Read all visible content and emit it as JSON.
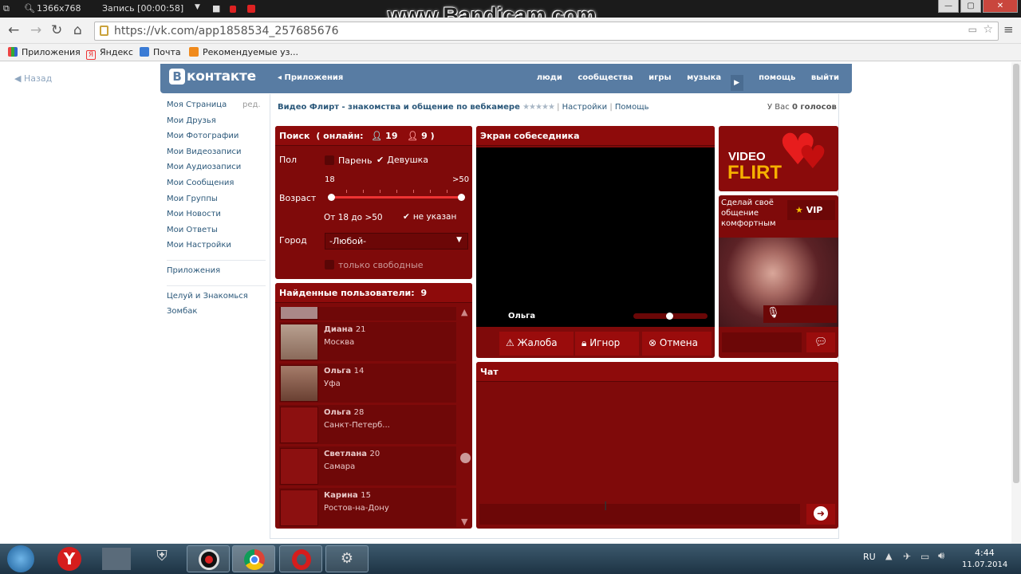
{
  "bandicam": {
    "resolution": "1366x768",
    "recording": "Запись [00:00:58]",
    "watermark": "www.Bandicam.com"
  },
  "browser": {
    "url": "https://vk.com/app1858534_257685676"
  },
  "bookmarks": [
    "Приложения",
    "Яндекс",
    "Почта",
    "Рекомендуемые уз..."
  ],
  "vk": {
    "logo": "контакте",
    "apps_link": "Приложения",
    "nav": [
      "люди",
      "сообщества",
      "игры",
      "музыка",
      "помощь",
      "выйти"
    ],
    "back": "Назад",
    "edit": "ред.",
    "sidebar": [
      "Моя Страница",
      "Мои Друзья",
      "Мои Фотографии",
      "Мои Видеозаписи",
      "Мои Аудиозаписи",
      "Мои Сообщения",
      "Мои Группы",
      "Мои Новости",
      "Мои Ответы",
      "Мои Настройки"
    ],
    "sidebar_apps": "Приложения",
    "sidebar_games": [
      "Целуй и Знакомься",
      "Зомбак"
    ],
    "app_title": "Видео Флирт - знакомства и общение по вебкамере",
    "stars": "★★★★★",
    "settings": "Настройки",
    "help": "Помощь",
    "votes_prefix": "У Вас",
    "votes_value": "0 голосов"
  },
  "app": {
    "search": {
      "title": "Поиск",
      "online_label": "( онлайн:",
      "online_male": "19",
      "online_female": "9",
      "close_paren": ")",
      "sex_label": "Пол",
      "male": "Парень",
      "female": "Девушка",
      "age_label": "Возраст",
      "age_min": "18",
      "age_max": ">50",
      "age_range": "От 18 до >50",
      "unspecified": "не указан",
      "city_label": "Город",
      "city_value": "-Любой-",
      "only_free": "только свободные"
    },
    "found": {
      "title": "Найденные пользователи:",
      "count": "9",
      "users": [
        {
          "name": "Диана",
          "age": "21",
          "city": "Москва"
        },
        {
          "name": "Ольга",
          "age": "14",
          "city": "Уфа"
        },
        {
          "name": "Ольга",
          "age": "28",
          "city": "Санкт-Петерб..."
        },
        {
          "name": "Светлана",
          "age": "20",
          "city": "Самара"
        },
        {
          "name": "Карина",
          "age": "15",
          "city": "Ростов-на-Дону"
        }
      ]
    },
    "partner": {
      "title": "Экран собеседника",
      "name": "Ольга",
      "complain": "Жалоба",
      "ignore": "Игнор",
      "cancel": "Отмена"
    },
    "brand": {
      "line1": "VIDEO",
      "line2": "FLIRT"
    },
    "vip": {
      "text": "Сделай своё общение комфортным",
      "label": "VIP"
    },
    "chat": {
      "title": "Чат"
    }
  },
  "taskbar": {
    "lang": "RU",
    "time": "4:44",
    "date": "11.07.2014"
  },
  "colors": {
    "app_bg": "#7f0a0a",
    "vk_blue": "#587ca3"
  }
}
